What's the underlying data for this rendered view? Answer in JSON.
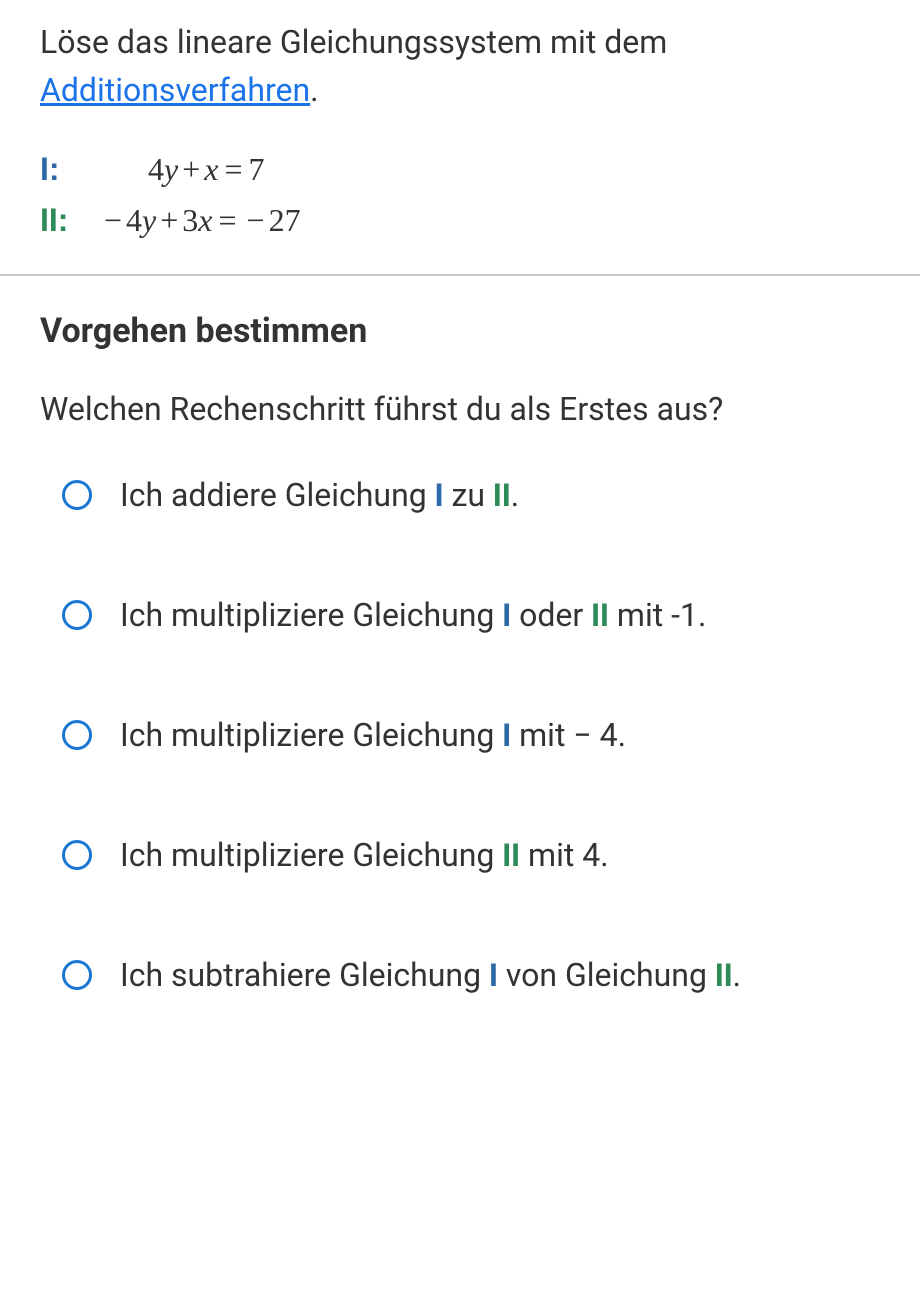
{
  "problem": {
    "intro_prefix": "Löse das lineare Gleichungssystem mit dem ",
    "link_text": "Additionsverfahren",
    "intro_suffix": ".",
    "equations": {
      "I": {
        "label": "I:",
        "expr": "4y + x = 7"
      },
      "II": {
        "label": "II:",
        "expr": "− 4y + 3x = − 27"
      }
    }
  },
  "question": {
    "heading": "Vorgehen bestimmen",
    "prompt": "Welchen Rechenschritt führst du als Erstes aus?",
    "options": [
      {
        "prefix": "Ich addiere Gleichung ",
        "mark1": "I",
        "mid": " zu ",
        "mark2": "II",
        "suffix": "."
      },
      {
        "prefix": "Ich multipliziere Gleichung ",
        "mark1": "I",
        "mid": " oder ",
        "mark2": "II",
        "suffix": " mit -1."
      },
      {
        "prefix": "Ich multipliziere Gleichung ",
        "mark1": "I",
        "mid": "",
        "mark2": "",
        "suffix": " mit − 4."
      },
      {
        "prefix": "Ich multipliziere Gleichung ",
        "mark1": "",
        "mid": "",
        "mark2": "II",
        "suffix": " mit 4."
      },
      {
        "prefix": "Ich subtrahiere Gleichung ",
        "mark1": "I",
        "mid": " von Gleichung ",
        "mark2": "II",
        "suffix": "."
      }
    ]
  }
}
